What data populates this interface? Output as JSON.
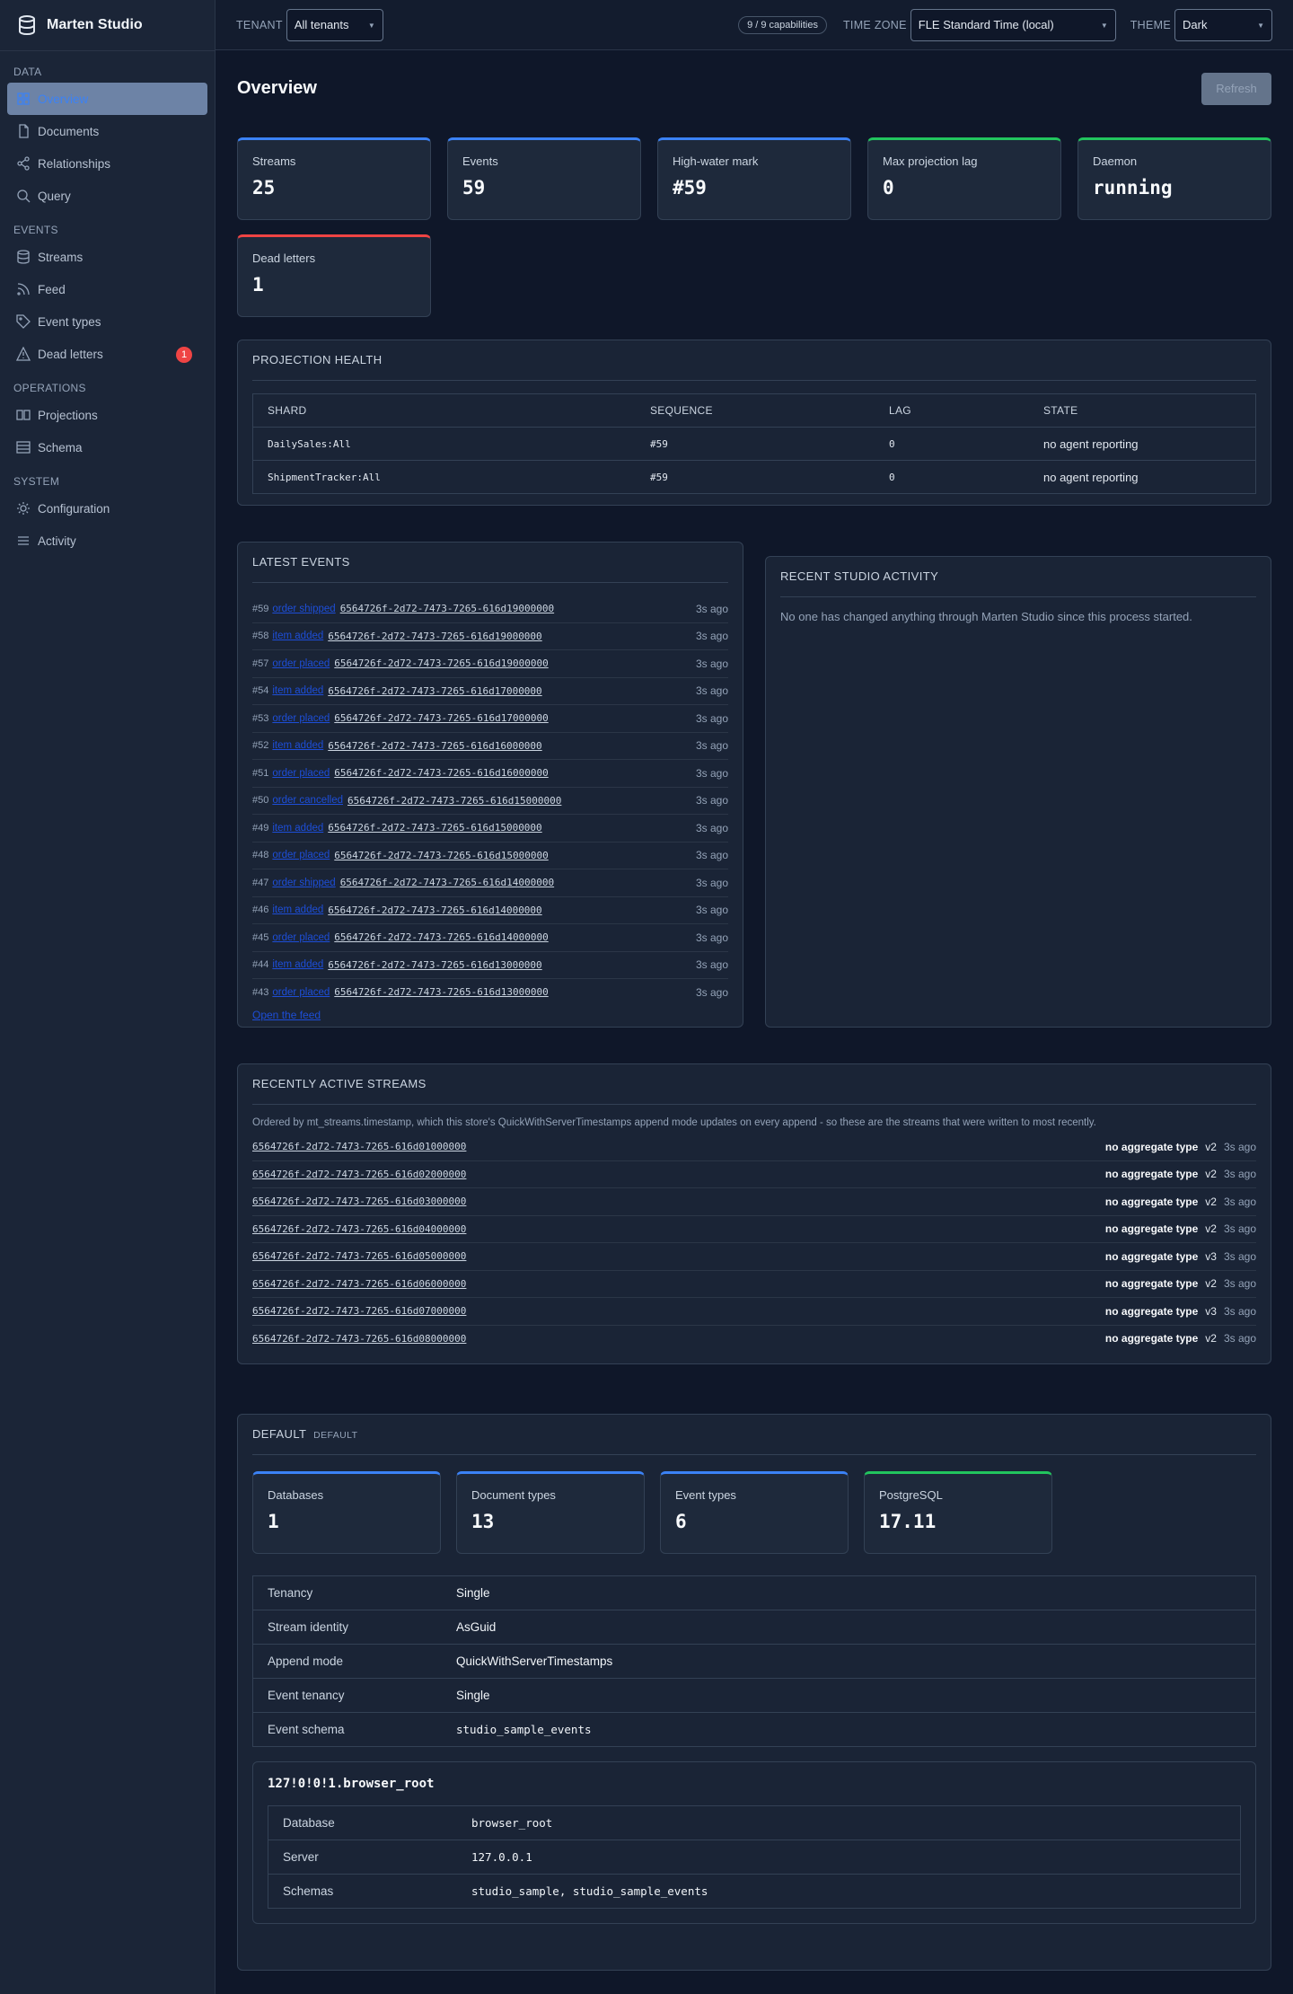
{
  "app": {
    "title": "Marten Studio"
  },
  "sidebar": {
    "sections": [
      {
        "label": "DATA",
        "items": [
          {
            "label": "Overview",
            "icon": "grid-icon",
            "active": true
          },
          {
            "label": "Documents",
            "icon": "document-icon"
          },
          {
            "label": "Relationships",
            "icon": "share-icon"
          },
          {
            "label": "Query",
            "icon": "search-icon"
          }
        ]
      },
      {
        "label": "EVENTS",
        "items": [
          {
            "label": "Streams",
            "icon": "database-icon"
          },
          {
            "label": "Feed",
            "icon": "rss-icon"
          },
          {
            "label": "Event types",
            "icon": "tag-icon"
          },
          {
            "label": "Dead letters",
            "icon": "warning-icon",
            "badge": "1"
          }
        ]
      },
      {
        "label": "OPERATIONS",
        "items": [
          {
            "label": "Projections",
            "icon": "columns-icon"
          },
          {
            "label": "Schema",
            "icon": "table-icon"
          }
        ]
      },
      {
        "label": "SYSTEM",
        "items": [
          {
            "label": "Configuration",
            "icon": "gear-icon"
          },
          {
            "label": "Activity",
            "icon": "list-icon"
          }
        ]
      }
    ]
  },
  "topbar": {
    "tenant_label": "TENANT",
    "tenant_value": "All tenants",
    "capabilities": "9 / 9 capabilities",
    "timezone_label": "TIME ZONE",
    "timezone_value": "FLE Standard Time (local)",
    "theme_label": "THEME",
    "theme_value": "Dark"
  },
  "page": {
    "title": "Overview",
    "refresh_label": "Refresh"
  },
  "stats": [
    {
      "label": "Streams",
      "value": "25",
      "accent": "#3b82f6"
    },
    {
      "label": "Events",
      "value": "59",
      "accent": "#3b82f6"
    },
    {
      "label": "High-water mark",
      "value": "#59",
      "accent": "#3b82f6"
    },
    {
      "label": "Max projection lag",
      "value": "0",
      "accent": "#22c55e"
    },
    {
      "label": "Daemon",
      "value": "running",
      "accent": "#22c55e"
    },
    {
      "label": "Dead letters",
      "value": "1",
      "accent": "#ef4444"
    }
  ],
  "projection_health": {
    "title": "PROJECTION HEALTH",
    "columns": [
      "SHARD",
      "SEQUENCE",
      "LAG",
      "STATE"
    ],
    "rows": [
      [
        "DailySales:All",
        "#59",
        "0",
        "no agent reporting"
      ],
      [
        "ShipmentTracker:All",
        "#59",
        "0",
        "no agent reporting"
      ]
    ]
  },
  "latest_events": {
    "title": "LATEST EVENTS",
    "rows": [
      {
        "num": "#59",
        "type": "order shipped",
        "stream": "6564726f-2d72-7473-7265-616d19000000",
        "ago": "3s ago"
      },
      {
        "num": "#58",
        "type": "item added",
        "stream": "6564726f-2d72-7473-7265-616d19000000",
        "ago": "3s ago"
      },
      {
        "num": "#57",
        "type": "order placed",
        "stream": "6564726f-2d72-7473-7265-616d19000000",
        "ago": "3s ago"
      },
      {
        "num": "#54",
        "type": "item added",
        "stream": "6564726f-2d72-7473-7265-616d17000000",
        "ago": "3s ago"
      },
      {
        "num": "#53",
        "type": "order placed",
        "stream": "6564726f-2d72-7473-7265-616d17000000",
        "ago": "3s ago"
      },
      {
        "num": "#52",
        "type": "item added",
        "stream": "6564726f-2d72-7473-7265-616d16000000",
        "ago": "3s ago"
      },
      {
        "num": "#51",
        "type": "order placed",
        "stream": "6564726f-2d72-7473-7265-616d16000000",
        "ago": "3s ago"
      },
      {
        "num": "#50",
        "type": "order cancelled",
        "stream": "6564726f-2d72-7473-7265-616d15000000",
        "ago": "3s ago"
      },
      {
        "num": "#49",
        "type": "item added",
        "stream": "6564726f-2d72-7473-7265-616d15000000",
        "ago": "3s ago"
      },
      {
        "num": "#48",
        "type": "order placed",
        "stream": "6564726f-2d72-7473-7265-616d15000000",
        "ago": "3s ago"
      },
      {
        "num": "#47",
        "type": "order shipped",
        "stream": "6564726f-2d72-7473-7265-616d14000000",
        "ago": "3s ago"
      },
      {
        "num": "#46",
        "type": "item added",
        "stream": "6564726f-2d72-7473-7265-616d14000000",
        "ago": "3s ago"
      },
      {
        "num": "#45",
        "type": "order placed",
        "stream": "6564726f-2d72-7473-7265-616d14000000",
        "ago": "3s ago"
      },
      {
        "num": "#44",
        "type": "item added",
        "stream": "6564726f-2d72-7473-7265-616d13000000",
        "ago": "3s ago"
      },
      {
        "num": "#43",
        "type": "order placed",
        "stream": "6564726f-2d72-7473-7265-616d13000000",
        "ago": "3s ago"
      }
    ],
    "open_feed": "Open the feed"
  },
  "recent_activity": {
    "title": "RECENT STUDIO ACTIVITY",
    "empty": "No one has changed anything through Marten Studio since this process started."
  },
  "active_streams": {
    "title": "RECENTLY ACTIVE STREAMS",
    "note": "Ordered by mt_streams.timestamp, which this store's QuickWithServerTimestamps append mode updates on every append - so these are the streams that were written to most recently.",
    "rows": [
      {
        "id": "6564726f-2d72-7473-7265-616d01000000",
        "agg": "no aggregate type",
        "ver": "v2",
        "ago": "3s ago"
      },
      {
        "id": "6564726f-2d72-7473-7265-616d02000000",
        "agg": "no aggregate type",
        "ver": "v2",
        "ago": "3s ago"
      },
      {
        "id": "6564726f-2d72-7473-7265-616d03000000",
        "agg": "no aggregate type",
        "ver": "v2",
        "ago": "3s ago"
      },
      {
        "id": "6564726f-2d72-7473-7265-616d04000000",
        "agg": "no aggregate type",
        "ver": "v2",
        "ago": "3s ago"
      },
      {
        "id": "6564726f-2d72-7473-7265-616d05000000",
        "agg": "no aggregate type",
        "ver": "v3",
        "ago": "3s ago"
      },
      {
        "id": "6564726f-2d72-7473-7265-616d06000000",
        "agg": "no aggregate type",
        "ver": "v2",
        "ago": "3s ago"
      },
      {
        "id": "6564726f-2d72-7473-7265-616d07000000",
        "agg": "no aggregate type",
        "ver": "v3",
        "ago": "3s ago"
      },
      {
        "id": "6564726f-2d72-7473-7265-616d08000000",
        "agg": "no aggregate type",
        "ver": "v2",
        "ago": "3s ago"
      }
    ]
  },
  "store": {
    "title": "DEFAULT",
    "tag": "DEFAULT",
    "stats": [
      {
        "label": "Databases",
        "value": "1",
        "accent": "#3b82f6"
      },
      {
        "label": "Document types",
        "value": "13",
        "accent": "#3b82f6"
      },
      {
        "label": "Event types",
        "value": "6",
        "accent": "#3b82f6"
      },
      {
        "label": "PostgreSQL",
        "value": "17.11",
        "accent": "#22c55e"
      }
    ],
    "props": [
      {
        "k": "Tenancy",
        "v": "Single",
        "mono": false
      },
      {
        "k": "Stream identity",
        "v": "AsGuid",
        "mono": false
      },
      {
        "k": "Append mode",
        "v": "QuickWithServerTimestamps",
        "mono": false
      },
      {
        "k": "Event tenancy",
        "v": "Single",
        "mono": false
      },
      {
        "k": "Event schema",
        "v": "studio_sample_events",
        "mono": true
      }
    ],
    "db_title": "127!0!0!1.browser_root",
    "db_props": [
      {
        "k": "Database",
        "v": "browser_root"
      },
      {
        "k": "Server",
        "v": "127.0.0.1"
      },
      {
        "k": "Schemas",
        "v": "studio_sample, studio_sample_events"
      }
    ]
  }
}
